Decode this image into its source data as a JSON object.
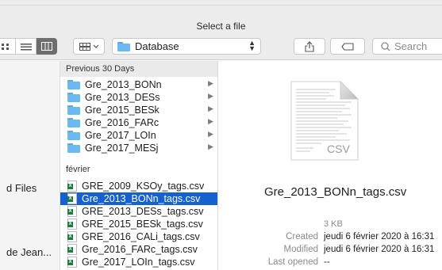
{
  "window": {
    "title": "Select a file"
  },
  "toolbar": {
    "location_label": "Database",
    "search_placeholder": "Search"
  },
  "sidebar": {
    "items": [
      {
        "label": "d Files"
      },
      {
        "label": "de Jean..."
      }
    ]
  },
  "column": {
    "sections": [
      {
        "label": "Previous 30 Days"
      },
      {
        "label": "février"
      }
    ],
    "folders": [
      {
        "name": "Gre_2013_BONn"
      },
      {
        "name": "Gre_2013_DESs"
      },
      {
        "name": "Gre_2015_BESk"
      },
      {
        "name": "Gre_2016_FARc"
      },
      {
        "name": "Gre_2017_LOIn"
      },
      {
        "name": "Gre_2017_MESj"
      }
    ],
    "files": [
      {
        "name": "GRE_2009_KSOy_tags.csv",
        "selected": false
      },
      {
        "name": "Gre_2013_BONn_tags.csv",
        "selected": true
      },
      {
        "name": "GRE_2013_DESs_tags.csv",
        "selected": false
      },
      {
        "name": "GRE_2015_BESk_tags.csv",
        "selected": false
      },
      {
        "name": "GRE_2016_CALi_tags.csv",
        "selected": false
      },
      {
        "name": "Gre_2016_FARc_tags.csv",
        "selected": false
      },
      {
        "name": "Gre_2017_LOIn_tags.csv",
        "selected": false
      }
    ]
  },
  "preview": {
    "icon_label": "CSV",
    "file_name": "Gre_2013_BONn_tags.csv",
    "size": "3 KB",
    "created_label": "Created",
    "created_value": "jeudi 6 février 2020 à 16:31",
    "modified_label": "Modified",
    "modified_value": "jeudi 6 février 2020 à 16:31",
    "last_opened_label": "Last opened",
    "last_opened_value": "--"
  },
  "colors": {
    "selection": "#1561d0",
    "folder": "#6cb8f0",
    "toolbar_bg": "#ececec"
  }
}
